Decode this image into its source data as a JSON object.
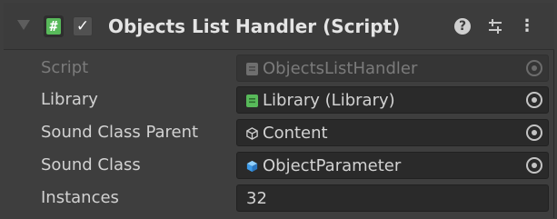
{
  "component": {
    "title": "Objects List Handler (Script)",
    "enabled_check": "✓",
    "script_glyph": "#",
    "help_glyph": "?",
    "menu_glyph": "⋮"
  },
  "fields": [
    {
      "label": "Script",
      "value": "ObjectsListHandler",
      "icon": "script-icon",
      "disabled": true
    },
    {
      "label": "Library",
      "value": "Library (Library)",
      "icon": "script-icon",
      "disabled": false
    },
    {
      "label": "Sound Class Parent",
      "value": "Content",
      "icon": "gameobject-icon",
      "disabled": false
    },
    {
      "label": "Sound Class",
      "value": "ObjectParameter",
      "icon": "prefab-icon",
      "disabled": false
    },
    {
      "label": "Instances",
      "value": "32",
      "disabled": false
    }
  ],
  "colors": {
    "script_green": "#58b95a",
    "prefab_blue": "#3d9be9",
    "background": "#3e3e3e",
    "field_bg": "#2a2a2a"
  }
}
